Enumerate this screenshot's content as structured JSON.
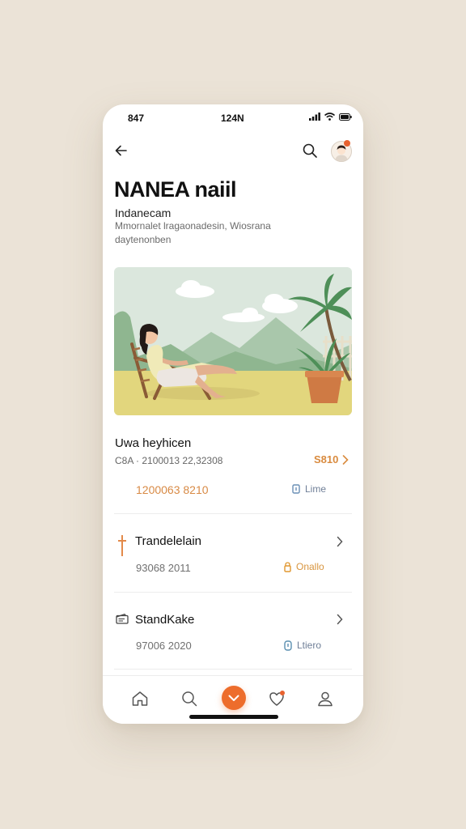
{
  "status": {
    "left_time": "847",
    "center_time": "124N"
  },
  "header": {
    "title": "NANEA naiil",
    "subtitle": "Indanecam",
    "description": "Mmornalet lragaonadesin, Wiosrana daytenonben"
  },
  "summary": {
    "title": "Uwa heyhicen",
    "subtext": "C8A · 2100013 22,32308",
    "link_label": "S810",
    "amount": "1200063 8210",
    "tag_label": "Lime"
  },
  "rows": [
    {
      "title": "Trandelelain",
      "value": "93068 2011",
      "tag_label": "Onallo"
    },
    {
      "title": "StandKake",
      "value": "97006 2020",
      "tag_label": "Ltiero"
    }
  ],
  "colors": {
    "accent": "#ed6d2c",
    "link": "#d98b3f",
    "background": "#ebe3d7"
  },
  "icons": {
    "back": "back-arrow-icon",
    "search": "search-icon",
    "avatar": "avatar",
    "home": "home-icon",
    "nav_search": "search-icon",
    "center": "chevron-down-icon",
    "favorites": "heart-icon",
    "profile": "profile-icon"
  }
}
